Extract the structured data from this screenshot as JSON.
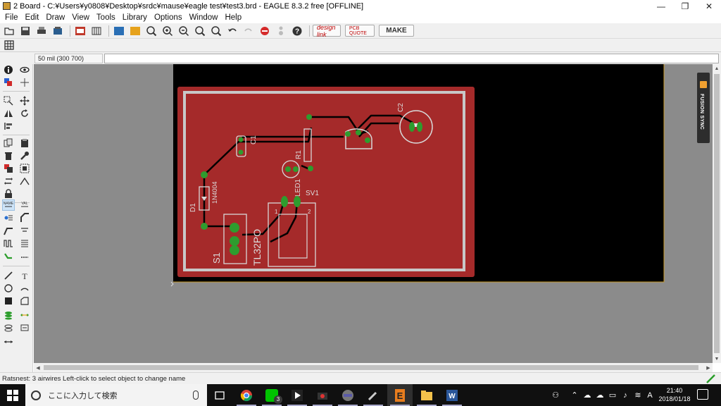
{
  "window": {
    "title": "2 Board - C:¥Users¥y0808¥Desktop¥srdc¥mause¥eagle test¥test3.brd - EAGLE 8.3.2 free [OFFLINE]",
    "minimize": "—",
    "maximize": "❐",
    "close": "✕"
  },
  "menu": [
    "File",
    "Edit",
    "Draw",
    "View",
    "Tools",
    "Library",
    "Options",
    "Window",
    "Help"
  ],
  "toolbar": {
    "design_link": "design link",
    "pcb_quote": "PCB QUOTE",
    "make": "MAKE"
  },
  "coordinate": "50 mil (300 700)",
  "fusion_sync": "FUSION SYNC",
  "board": {
    "colors": {
      "background": "#000000",
      "board_fill": "#a52a2a",
      "outline": "#c8c8c8",
      "trace": "#000000",
      "pad": "#2e9c2e",
      "silk": "#dcdcdc"
    },
    "labels": {
      "c1": "C1",
      "c2": "C2",
      "r1": "R1",
      "d1": "D1",
      "d1_part": "1N4004",
      "led": "LED1",
      "sv1": "SV1",
      "s1": "S1",
      "s1_part": "TL32PO",
      "pin1": "1",
      "pin2": "2"
    }
  },
  "status": "Ratsnest: 3 airwires Left-click to select object to change name",
  "taskbar": {
    "search_placeholder": "ここに入力して検索",
    "badge_count": "3",
    "ime": "A",
    "clock_time": "21:40",
    "clock_date": "2018/01/18"
  }
}
